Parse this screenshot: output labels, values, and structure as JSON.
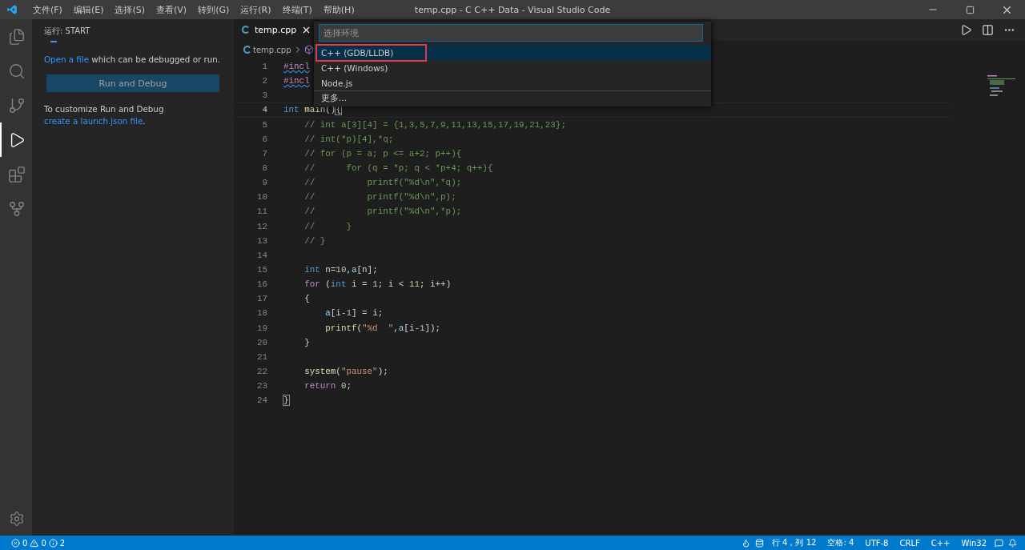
{
  "title_bar": {
    "menus": [
      "文件(F)",
      "编辑(E)",
      "选择(S)",
      "查看(V)",
      "转到(G)",
      "运行(R)",
      "终端(T)",
      "帮助(H)"
    ],
    "title": "temp.cpp - C C++ Data - Visual Studio Code"
  },
  "activity_bar": {
    "items": [
      {
        "kind": "explorer",
        "selected": false
      },
      {
        "kind": "search",
        "selected": false
      },
      {
        "kind": "source-control",
        "selected": false
      },
      {
        "kind": "run-debug",
        "selected": true
      },
      {
        "kind": "extensions",
        "selected": false
      },
      {
        "kind": "git-graph",
        "selected": false
      }
    ]
  },
  "sidebar": {
    "title": "运行: START",
    "intro_link": "Open a file",
    "intro_text": " which can be debugged or run.",
    "button": "Run and Debug",
    "customize_text": "To customize Run and Debug ",
    "customize_link": "create a launch.json file",
    "customize_end": "."
  },
  "editor": {
    "tabs": [
      {
        "label": "temp.cpp",
        "selected": true
      }
    ],
    "breadcrumb": "temp.cpp",
    "lines": [
      {
        "number": "1",
        "current": false,
        "tokens": [
          {
            "text": "#incl",
            "kind": "include"
          }
        ]
      },
      {
        "number": "2",
        "current": false,
        "tokens": [
          {
            "text": "#incl",
            "kind": "include"
          }
        ]
      },
      {
        "number": "3",
        "current": false
      },
      {
        "number": "4",
        "current": true,
        "tokens": [
          {
            "text": "int",
            "kind": "keyword"
          },
          {
            "text": " main",
            "kind": "function"
          },
          {
            "text": "()",
            "kind": "plain"
          },
          {
            "text": "{",
            "kind": "bracket"
          }
        ]
      },
      {
        "number": "5",
        "current": false,
        "tokens": [
          {
            "text": "    // int a[3][4] = {1,3,5,7,9,11,13,15,17,19,21,23};",
            "kind": "comment"
          }
        ]
      },
      {
        "number": "6",
        "current": false,
        "tokens": [
          {
            "text": "    // int(*p)[4],*q;",
            "kind": "comment"
          }
        ]
      },
      {
        "number": "7",
        "current": false,
        "tokens": [
          {
            "text": "    // for (p = a; p <= a+2; p++){",
            "kind": "comment"
          }
        ]
      },
      {
        "number": "8",
        "current": false,
        "tokens": [
          {
            "text": "    //      for (q = *p; q < *p+4; q++){",
            "kind": "comment"
          }
        ]
      },
      {
        "number": "9",
        "current": false,
        "tokens": [
          {
            "text": "    //          printf(\"%d\\n\",*q);",
            "kind": "comment"
          }
        ]
      },
      {
        "number": "10",
        "current": false,
        "tokens": [
          {
            "text": "    //          printf(\"%d\\n\",p);",
            "kind": "comment"
          }
        ]
      },
      {
        "number": "11",
        "current": false,
        "tokens": [
          {
            "text": "    //          printf(\"%d\\n\",*p);",
            "kind": "comment"
          }
        ]
      },
      {
        "number": "12",
        "current": false,
        "tokens": [
          {
            "text": "    //      }",
            "kind": "comment"
          }
        ]
      },
      {
        "number": "13",
        "current": false,
        "tokens": [
          {
            "text": "    // }",
            "kind": "comment"
          }
        ]
      },
      {
        "number": "14",
        "current": false
      },
      {
        "number": "15",
        "current": false,
        "tokens": [
          {
            "text": "    int",
            "kind": "keyword"
          },
          {
            "text": " n=",
            "kind": "plain"
          },
          {
            "text": "10",
            "kind": "number"
          },
          {
            "text": ",",
            "kind": "plain"
          },
          {
            "text": "a",
            "kind": "variable"
          },
          {
            "text": "[n];",
            "kind": "plain"
          }
        ]
      },
      {
        "number": "16",
        "current": false,
        "tokens": [
          {
            "text": "    for",
            "kind": "control"
          },
          {
            "text": " (",
            "kind": "plain"
          },
          {
            "text": "int",
            "kind": "keyword"
          },
          {
            "text": " i = ",
            "kind": "plain"
          },
          {
            "text": "1",
            "kind": "number"
          },
          {
            "text": "; i < ",
            "kind": "plain"
          },
          {
            "text": "11",
            "kind": "number"
          },
          {
            "text": "; i++)",
            "kind": "plain"
          }
        ]
      },
      {
        "number": "17",
        "current": false,
        "tokens": [
          {
            "text": "    {",
            "kind": "plain"
          }
        ]
      },
      {
        "number": "18",
        "current": false,
        "tokens": [
          {
            "text": "        a",
            "kind": "variable"
          },
          {
            "text": "[i-",
            "kind": "plain"
          },
          {
            "text": "1",
            "kind": "number"
          },
          {
            "text": "] = i;",
            "kind": "plain"
          }
        ]
      },
      {
        "number": "19",
        "current": false,
        "tokens": [
          {
            "text": "        printf",
            "kind": "function"
          },
          {
            "text": "(",
            "kind": "plain"
          },
          {
            "text": "\"%d  \"",
            "kind": "string"
          },
          {
            "text": ",",
            "kind": "plain"
          },
          {
            "text": "a",
            "kind": "variable"
          },
          {
            "text": "[i-",
            "kind": "plain"
          },
          {
            "text": "1",
            "kind": "number"
          },
          {
            "text": "]);",
            "kind": "plain"
          }
        ]
      },
      {
        "number": "20",
        "current": false,
        "tokens": [
          {
            "text": "    }",
            "kind": "plain"
          }
        ]
      },
      {
        "number": "21",
        "current": false
      },
      {
        "number": "22",
        "current": false,
        "tokens": [
          {
            "text": "    system",
            "kind": "function"
          },
          {
            "text": "(",
            "kind": "plain"
          },
          {
            "text": "\"pause\"",
            "kind": "string"
          },
          {
            "text": ");",
            "kind": "plain"
          }
        ]
      },
      {
        "number": "23",
        "current": false,
        "tokens": [
          {
            "text": "    return",
            "kind": "control"
          },
          {
            "text": " 0",
            "kind": "number"
          },
          {
            "text": ";",
            "kind": "plain"
          }
        ]
      },
      {
        "number": "24",
        "current": false,
        "tokens": [
          {
            "text": "}",
            "kind": "bracket"
          }
        ]
      }
    ]
  },
  "quick_pick": {
    "placeholder": "选择环境",
    "items": [
      {
        "label": "C++ (GDB/LLDB)",
        "selected": true,
        "marked": true,
        "separated": false
      },
      {
        "label": "C++ (Windows)",
        "selected": false,
        "marked": false,
        "separated": false
      },
      {
        "label": "Node.js",
        "selected": false,
        "marked": false,
        "separated": false
      },
      {
        "label": "更多...",
        "selected": false,
        "marked": false,
        "separated": true
      }
    ]
  },
  "status_bar": {
    "errors": "0",
    "warnings": "0",
    "infos": "2",
    "items": [
      "行 4，列 12",
      "空格: 4",
      "UTF-8",
      "CRLF",
      "C++",
      "Win32"
    ]
  }
}
